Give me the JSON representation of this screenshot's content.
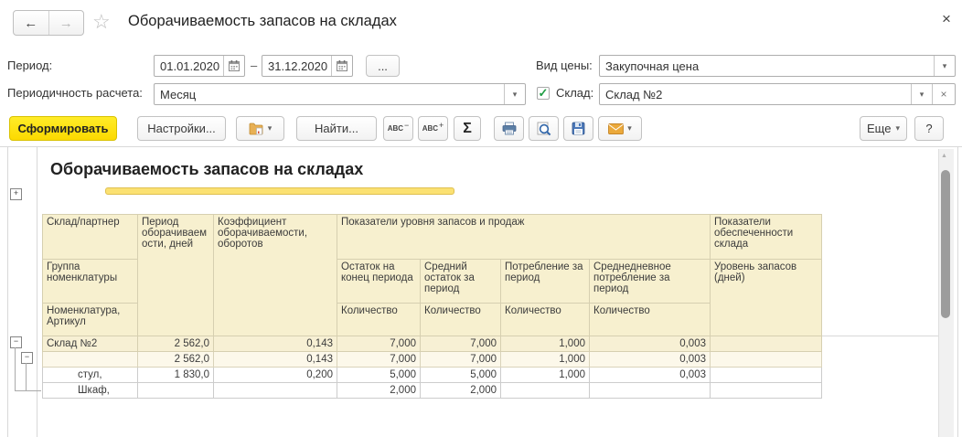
{
  "window": {
    "title": "Оборачиваемость запасов на складах"
  },
  "icons": {
    "back": "←",
    "forward": "→",
    "favorite": "☆",
    "close": "×",
    "dropdown": "▾",
    "clear": "×",
    "check": "✓",
    "minus": "−",
    "plus": "+",
    "sum": "Σ",
    "scroll_up": "▲",
    "dash": "–"
  },
  "filters": {
    "period_label": "Период:",
    "date_from": "01.01.2020",
    "date_to": "31.12.2020",
    "more_dates": "...",
    "periodicity_label": "Периодичность расчета:",
    "periodicity_value": "Месяц",
    "price_type_label": "Вид цены:",
    "price_type_value": "Закупочная цена",
    "warehouse_label": "Склад:",
    "warehouse_value": "Склад №2"
  },
  "toolbar": {
    "generate": "Сформировать",
    "settings": "Настройки...",
    "find": "Найти...",
    "abc_label": "ABC",
    "more": "Еще",
    "help": "?"
  },
  "report": {
    "title": "Оборачиваемость запасов на складах",
    "table": {
      "header": {
        "warehouse_partner": "Склад/партнер",
        "nomenclature_group": "Группа номенклатуры",
        "nomenclature_article": "Номенклатура, Артикул",
        "turnover_period": "Период оборачиваемости, дней",
        "turnover_ratio": "Коэффициент оборачиваемости, оборотов",
        "stock_sales_group": "Показатели уровня запасов и продаж",
        "end_balance": "Остаток на конец периода",
        "avg_balance": "Средний остаток за период",
        "consumption": "Потребление за период",
        "avg_daily_consumption": "Среднедневное потребление за период",
        "supply_group": "Показатели обеспеченности склада",
        "stock_level": "Уровень запасов (дней)",
        "quantity": "Количество"
      },
      "rows": [
        {
          "name": "Склад №2",
          "values": [
            "2 562,0",
            "0,143",
            "7,000",
            "7,000",
            "1,000",
            "0,003",
            ""
          ]
        },
        {
          "name": "",
          "values": [
            "2 562,0",
            "0,143",
            "7,000",
            "7,000",
            "1,000",
            "0,003",
            ""
          ]
        },
        {
          "name": "стул,",
          "values": [
            "1 830,0",
            "0,200",
            "5,000",
            "5,000",
            "1,000",
            "0,003",
            ""
          ]
        },
        {
          "name": "Шкаф,",
          "values": [
            "",
            "",
            "2,000",
            "2,000",
            "",
            "",
            ""
          ]
        }
      ]
    }
  }
}
